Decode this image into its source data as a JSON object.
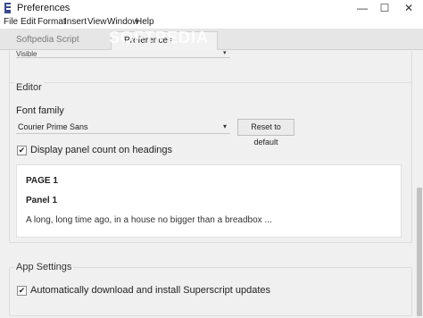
{
  "window": {
    "title": "Preferences",
    "minimize_glyph": "—",
    "maximize_glyph": "☐",
    "close_glyph": "✕"
  },
  "menu": [
    "File",
    "Edit",
    "Format",
    "Insert",
    "View",
    "Window",
    "Help"
  ],
  "tabs": [
    {
      "label": "Softpedia Script",
      "active": false
    },
    {
      "label": "Preferences",
      "active": true
    }
  ],
  "watermark": "SOFTPEDIA",
  "previous_section": {
    "select_value": "Visible",
    "arrow": "▾"
  },
  "editor": {
    "title": "Editor",
    "font_family_label": "Font family",
    "font_family_value": "Courier Prime Sans",
    "font_arrow": "▾",
    "reset_button": "Reset to default",
    "display_panel_count_label": "Display panel count on headings",
    "display_panel_count_checked": true,
    "check_glyph": "✔",
    "preview": {
      "page": "PAGE 1",
      "panel": "Panel 1",
      "text": "A long, long time ago, in a house no bigger than a breadbox ..."
    }
  },
  "app_settings": {
    "title": "App Settings",
    "auto_update_label": "Automatically download and install Superscript updates",
    "auto_update_checked": true
  }
}
